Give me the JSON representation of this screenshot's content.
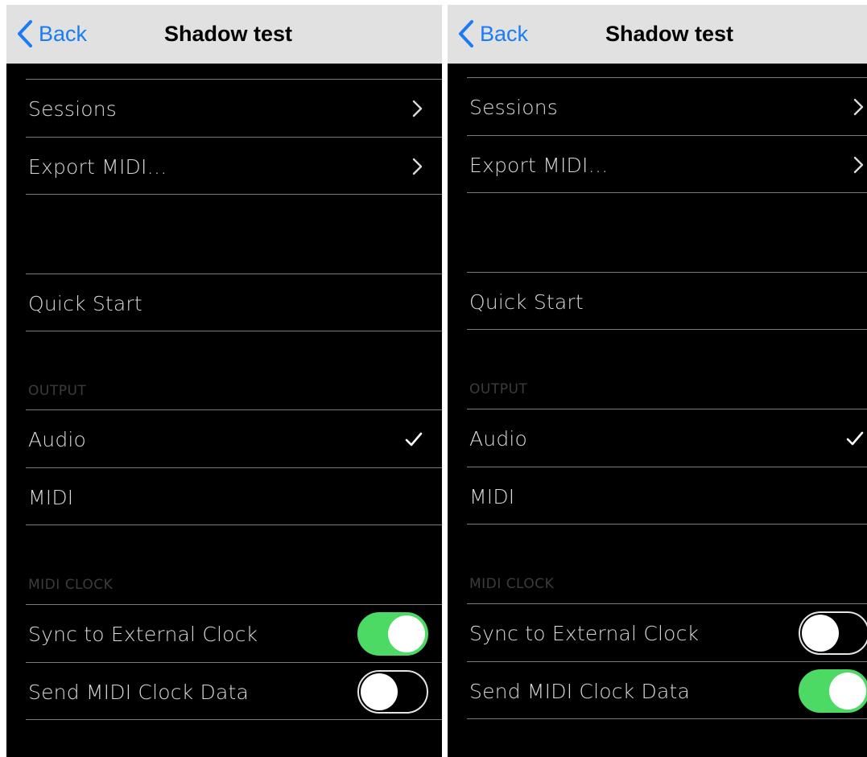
{
  "screens": [
    {
      "nav": {
        "back_label": "Back",
        "title": "Shadow test"
      },
      "rows": {
        "sessions": "Sessions",
        "export_midi": "Export MIDI…",
        "quick_start": "Quick Start",
        "audio": "Audio",
        "midi": "MIDI",
        "sync_external_clock": "Sync to External Clock",
        "send_midi_clock": "Send MIDI Clock Data"
      },
      "sections": {
        "output": "OUTPUT",
        "midi_clock": "MIDI CLOCK"
      },
      "selected_output": "Audio",
      "toggles": {
        "sync_external_clock": true,
        "send_midi_clock": false
      }
    },
    {
      "nav": {
        "back_label": "Back",
        "title": "Shadow test"
      },
      "rows": {
        "sessions": "Sessions",
        "export_midi": "Export MIDI…",
        "quick_start": "Quick Start",
        "audio": "Audio",
        "midi": "MIDI",
        "sync_external_clock": "Sync to External Clock",
        "send_midi_clock": "Send MIDI Clock Data"
      },
      "sections": {
        "output": "OUTPUT",
        "midi_clock": "MIDI CLOCK"
      },
      "selected_output": "Audio",
      "toggles": {
        "sync_external_clock": false,
        "send_midi_clock": true
      }
    }
  ],
  "colors": {
    "accent_blue": "#1a7cf5",
    "toggle_on": "#4cd964",
    "navbar_bg": "#e1e1e1",
    "list_bg": "#000000"
  },
  "icons": [
    "chevron-left-icon",
    "chevron-right-icon",
    "checkmark-icon"
  ]
}
